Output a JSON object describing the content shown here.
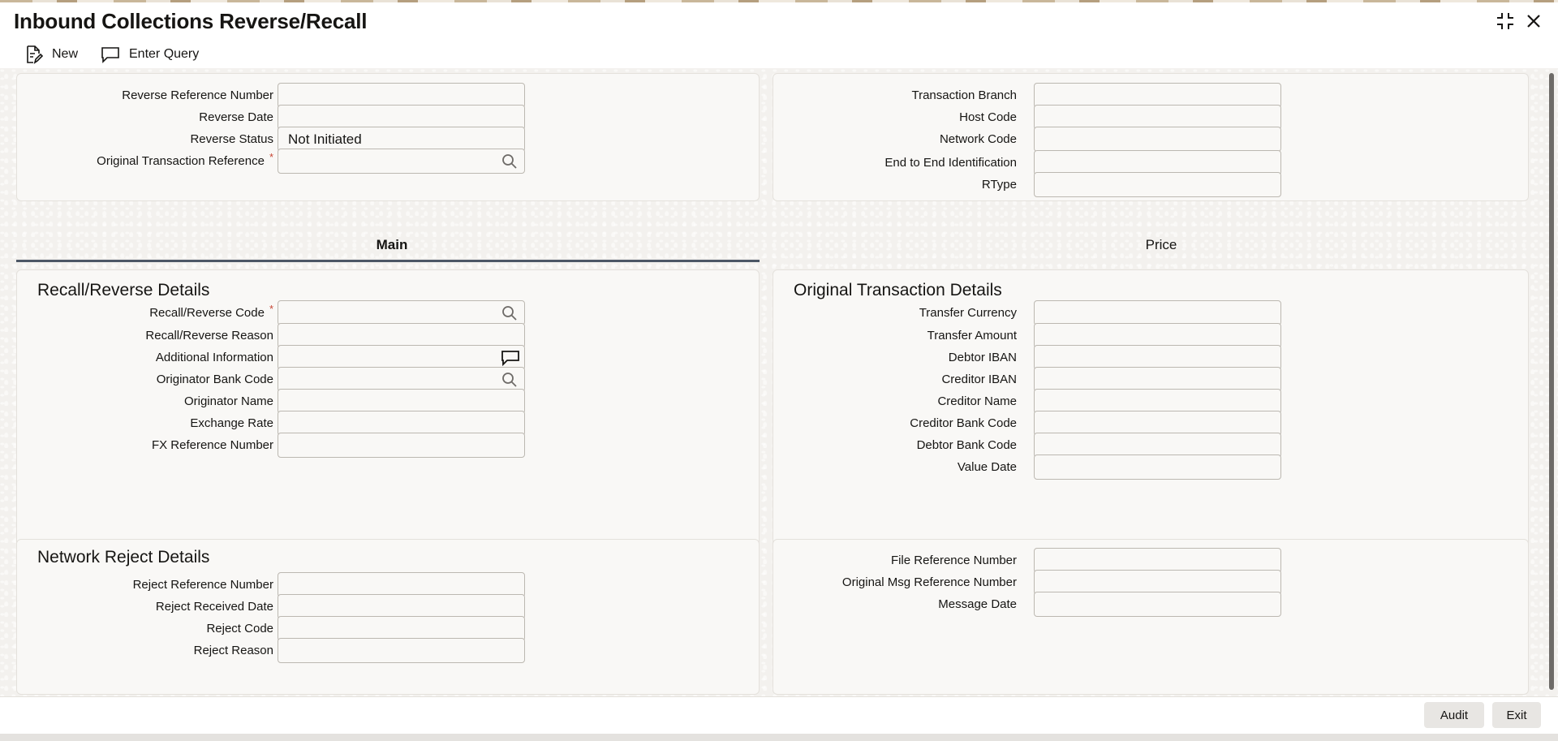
{
  "window": {
    "title": "Inbound Collections Reverse/Recall"
  },
  "toolbar": {
    "new_label": "New",
    "enter_query_label": "Enter Query"
  },
  "header_left": {
    "fields": [
      {
        "label": "Reverse Reference Number",
        "value": "",
        "required": false
      },
      {
        "label": "Reverse Date",
        "value": "",
        "required": false
      },
      {
        "label": "Reverse Status",
        "value": "Not Initiated",
        "required": false
      },
      {
        "label": "Original Transaction Reference",
        "value": "",
        "required": true
      }
    ]
  },
  "header_right": {
    "fields": [
      {
        "label": "Transaction Branch",
        "value": ""
      },
      {
        "label": "Host Code",
        "value": ""
      },
      {
        "label": "Network Code",
        "value": ""
      },
      {
        "label": "End to End Identification",
        "value": ""
      },
      {
        "label": "RType",
        "value": ""
      }
    ]
  },
  "tabs": [
    {
      "label": "Main",
      "active": true
    },
    {
      "label": "Price",
      "active": false
    }
  ],
  "recall_reverse": {
    "title": "Recall/Reverse Details",
    "fields": [
      {
        "label": "Recall/Reverse Code",
        "value": "",
        "required": true
      },
      {
        "label": "Recall/Reverse Reason",
        "value": ""
      },
      {
        "label": "Additional Information",
        "value": ""
      },
      {
        "label": "Originator Bank Code",
        "value": ""
      },
      {
        "label": "Originator Name",
        "value": ""
      },
      {
        "label": "Exchange Rate",
        "value": ""
      },
      {
        "label": "FX Reference Number",
        "value": ""
      }
    ]
  },
  "original_transaction": {
    "title": "Original Transaction Details",
    "fields": [
      {
        "label": "Transfer Currency",
        "value": ""
      },
      {
        "label": "Transfer Amount",
        "value": ""
      },
      {
        "label": "Debtor IBAN",
        "value": ""
      },
      {
        "label": "Creditor IBAN",
        "value": ""
      },
      {
        "label": "Creditor Name",
        "value": ""
      },
      {
        "label": "Creditor Bank Code",
        "value": ""
      },
      {
        "label": "Debtor Bank Code",
        "value": ""
      },
      {
        "label": "Value Date",
        "value": ""
      }
    ]
  },
  "network_reject": {
    "title": "Network Reject Details",
    "fields": [
      {
        "label": "Reject Reference Number",
        "value": ""
      },
      {
        "label": "Reject Received Date",
        "value": ""
      },
      {
        "label": "Reject Code",
        "value": ""
      },
      {
        "label": "Reject Reason",
        "value": ""
      }
    ]
  },
  "file_details": {
    "fields": [
      {
        "label": "File Reference Number",
        "value": ""
      },
      {
        "label": "Original Msg Reference Number",
        "value": ""
      },
      {
        "label": "Message Date",
        "value": ""
      }
    ]
  },
  "footer": {
    "audit_label": "Audit",
    "exit_label": "Exit"
  },
  "icons": {
    "new": "new-document-icon",
    "enter_query": "chat-bubble-icon",
    "search": "search-icon",
    "comment": "comment-icon",
    "collapse": "collapse-icon",
    "close": "close-icon"
  },
  "colors": {
    "required": "#c74634",
    "tab_underline": "#4c5766"
  }
}
